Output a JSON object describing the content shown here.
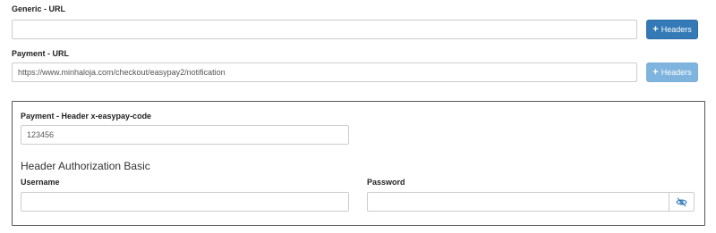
{
  "generic_url": {
    "label": "Generic - URL",
    "value": "",
    "button_label": "Headers"
  },
  "payment_url": {
    "label": "Payment - URL",
    "value": "https://www.minhaloja.com/checkout/easypay2/notification",
    "button_label": "Headers"
  },
  "header_box": {
    "code_label": "Payment - Header x-easypay-code",
    "code_value": "123456",
    "auth_title": "Header Authorization Basic",
    "username_label": "Username",
    "username_value": "",
    "password_label": "Password",
    "password_value": ""
  },
  "icons": {
    "plus": "plus-icon",
    "eye_slash": "eye-slash-icon"
  },
  "colors": {
    "primary_button": "#337ab7",
    "disabled_button": "#7eb4de",
    "eye_icon": "#337ab7"
  }
}
